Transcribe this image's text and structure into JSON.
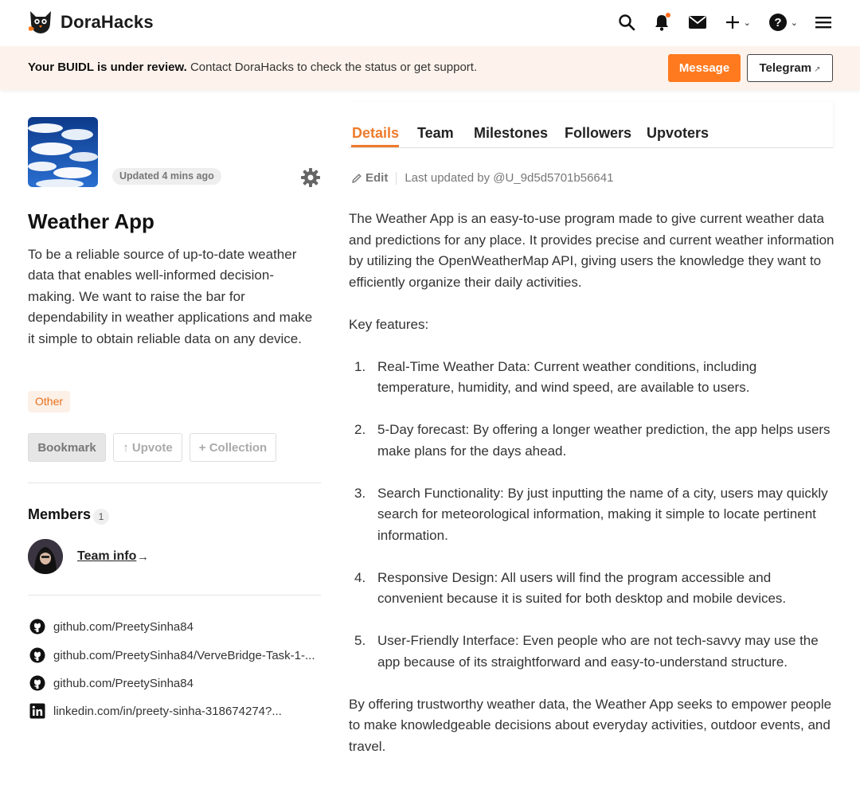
{
  "header": {
    "brand": "DoraHacks",
    "icons": [
      "search-icon",
      "bell-icon",
      "mail-icon",
      "plus-icon",
      "help-icon",
      "menu-icon"
    ],
    "accent": "#ff7a1f"
  },
  "banner": {
    "bold": "Your BUIDL is under review.",
    "text": " Contact DoraHacks to check the status or get support.",
    "message_label": "Message",
    "telegram_label": "Telegram"
  },
  "project": {
    "updated": "Updated 4 mins ago",
    "title": "Weather App",
    "tagline": "To be a reliable source of up-to-date weather data that enables well-informed decision-making. We want to raise the bar for dependability in weather applications and make it simple to obtain reliable data on any device.",
    "category": "Other",
    "bookmark_label": "Bookmark",
    "upvote_label": "↑ Upvote",
    "collection_label": "+ Collection"
  },
  "members": {
    "title": "Members",
    "count": "1",
    "team_info": "Team info",
    "arrow": "→"
  },
  "links": [
    {
      "icon": "github-icon",
      "text": "github.com/PreetySinha84"
    },
    {
      "icon": "github-icon",
      "text": "github.com/PreetySinha84/VerveBridge-Task-1-..."
    },
    {
      "icon": "github-icon",
      "text": "github.com/PreetySinha84"
    },
    {
      "icon": "linkedin-icon",
      "text": "linkedin.com/in/preety-sinha-318674274?..."
    }
  ],
  "tabs": [
    "Details",
    "Team",
    "Milestones",
    "Followers",
    "Upvoters"
  ],
  "details": {
    "edit_label": "Edit",
    "last_updated": "Last updated by @U_9d5d5701b56641",
    "intro": "The Weather App is an easy-to-use program made to give current weather data and predictions for any place. It provides precise and current weather information by utilizing the OpenWeatherMap API, giving users the knowledge they want to efficiently organize their daily activities.",
    "features_heading": "Key features:",
    "features": [
      {
        "num": "1.",
        "text": "Real-Time Weather Data: Current weather conditions, including temperature, humidity, and wind speed, are available to users."
      },
      {
        "num": "2.",
        "text": "5-Day forecast: By offering a longer weather prediction, the app helps users make plans for the days ahead."
      },
      {
        "num": "3.",
        "text": "Search Functionality: By just inputting the name of a city, users may quickly search for meteorological information, making it simple to locate pertinent information."
      },
      {
        "num": "4.",
        "text": "Responsive Design: All users will find the program accessible and convenient because it is suited for both desktop and mobile devices."
      },
      {
        "num": "5.",
        "text": "User-Friendly Interface: Even people who are not tech-savvy may use the app because of its straightforward and easy-to-understand structure."
      }
    ],
    "outro": "By offering trustworthy weather data, the Weather App seeks to empower people to make knowledgeable decisions about everyday activities, outdoor events, and travel."
  }
}
